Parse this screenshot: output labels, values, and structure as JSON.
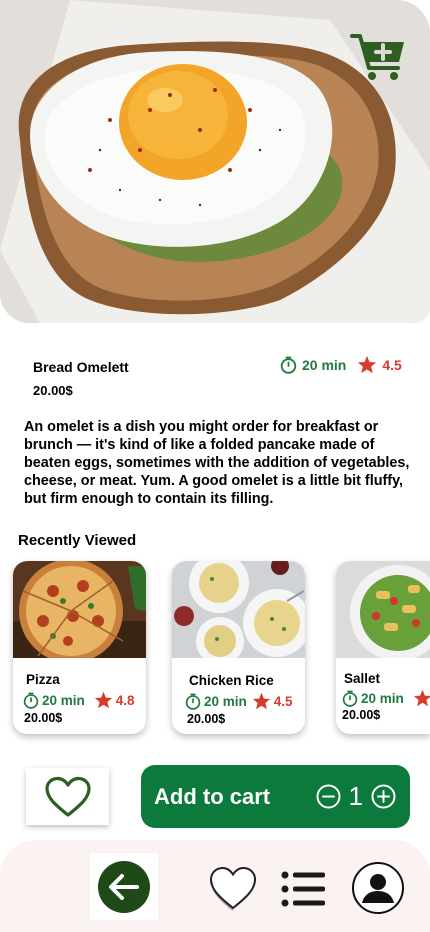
{
  "header": {
    "image_icon": "fried-egg-toast-photo",
    "cart_icon": "add-to-cart-icon"
  },
  "product": {
    "title": "Bread Omelett",
    "price": "20.00$",
    "time": "20 min",
    "rating": "4.5",
    "description": "An omelet is a dish you might order for breakfast or brunch — it's kind of like a folded pancake made of beaten eggs, sometimes with the addition of vegetables, cheese, or meat. Yum. A good omelet is a little bit fluffy, but firm enough to contain its filling."
  },
  "recent": {
    "title": "Recently Viewed",
    "items": [
      {
        "name": "Pizza",
        "time": "20 min",
        "rating": "4.8",
        "price": "20.00$"
      },
      {
        "name": "Chicken Rice",
        "time": "20 min",
        "rating": "4.5",
        "price": "20.00$"
      },
      {
        "name": "Sallet",
        "time": "20 min",
        "rating": "",
        "price": "20.00$"
      }
    ]
  },
  "actions": {
    "add_to_cart": "Add to cart",
    "quantity": "1"
  },
  "colors": {
    "brand_green": "#0b7a3c",
    "rating_red": "#d83a2c",
    "time_green": "#1f7a3c",
    "nav_bg": "#fbf3f1"
  },
  "nav": {
    "items": [
      "back-arrow-icon",
      "heart-icon",
      "list-icon",
      "profile-icon"
    ]
  }
}
